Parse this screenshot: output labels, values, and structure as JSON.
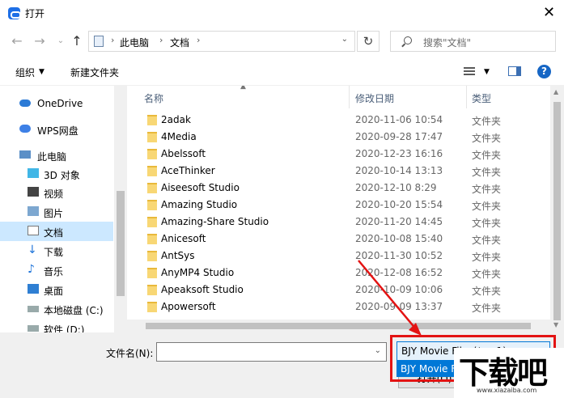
{
  "window": {
    "title": "打开",
    "close_icon": "close-icon"
  },
  "navigation": {
    "address": [
      "此电脑",
      "文档"
    ],
    "search_placeholder": "搜索\"文档\""
  },
  "toolbar": {
    "organize": "组织",
    "new_folder": "新建文件夹"
  },
  "sidebar": {
    "items": [
      {
        "label": "OneDrive",
        "icon": "cloud-icon"
      },
      {
        "label": "WPS网盘",
        "icon": "wps-cloud-icon"
      },
      {
        "label": "此电脑",
        "icon": "computer-icon"
      },
      {
        "label": "3D 对象",
        "icon": "cube-icon"
      },
      {
        "label": "视频",
        "icon": "video-icon"
      },
      {
        "label": "图片",
        "icon": "picture-icon"
      },
      {
        "label": "文档",
        "icon": "document-icon",
        "selected": true
      },
      {
        "label": "下载",
        "icon": "download-icon"
      },
      {
        "label": "音乐",
        "icon": "music-icon"
      },
      {
        "label": "桌面",
        "icon": "desktop-icon"
      },
      {
        "label": "本地磁盘 (C:)",
        "icon": "drive-icon"
      },
      {
        "label": "软件 (D:)",
        "icon": "drive-icon"
      }
    ]
  },
  "list": {
    "columns": [
      "名称",
      "修改日期",
      "类型"
    ],
    "rows": [
      {
        "name": "2adak",
        "date": "2020-11-06 10:54",
        "type": "文件夹"
      },
      {
        "name": "4Media",
        "date": "2020-09-28 17:47",
        "type": "文件夹"
      },
      {
        "name": "Abelssoft",
        "date": "2020-12-23 16:16",
        "type": "文件夹"
      },
      {
        "name": "AceThinker",
        "date": "2020-10-14 13:13",
        "type": "文件夹"
      },
      {
        "name": "Aiseesoft Studio",
        "date": "2020-12-10 8:29",
        "type": "文件夹"
      },
      {
        "name": "Amazing Studio",
        "date": "2020-10-20 15:54",
        "type": "文件夹"
      },
      {
        "name": "Amazing-Share Studio",
        "date": "2020-11-20 14:45",
        "type": "文件夹"
      },
      {
        "name": "Anicesoft",
        "date": "2020-10-08 15:40",
        "type": "文件夹"
      },
      {
        "name": "AntSys",
        "date": "2020-11-30 10:52",
        "type": "文件夹"
      },
      {
        "name": "AnyMP4 Studio",
        "date": "2020-12-08 16:52",
        "type": "文件夹"
      },
      {
        "name": "Apeaksoft Studio",
        "date": "2020-10-09 10:06",
        "type": "文件夹"
      },
      {
        "name": "Apowersoft",
        "date": "2020-09-09 13:37",
        "type": "文件夹"
      }
    ]
  },
  "bottom": {
    "filename_label": "文件名(N):",
    "filename_value": "",
    "filetype_value": "BJY Movie Files(*.ev1)",
    "filetype_option": "BJY Movie Files(*.ev1)",
    "open_button": "打开(O)"
  },
  "watermark": {
    "logo": "下载吧",
    "url": "www.xiazaiba.com"
  },
  "colors": {
    "accent": "#0078d7",
    "highlight_box": "#e31313",
    "selected_nav": "#cce8ff"
  }
}
